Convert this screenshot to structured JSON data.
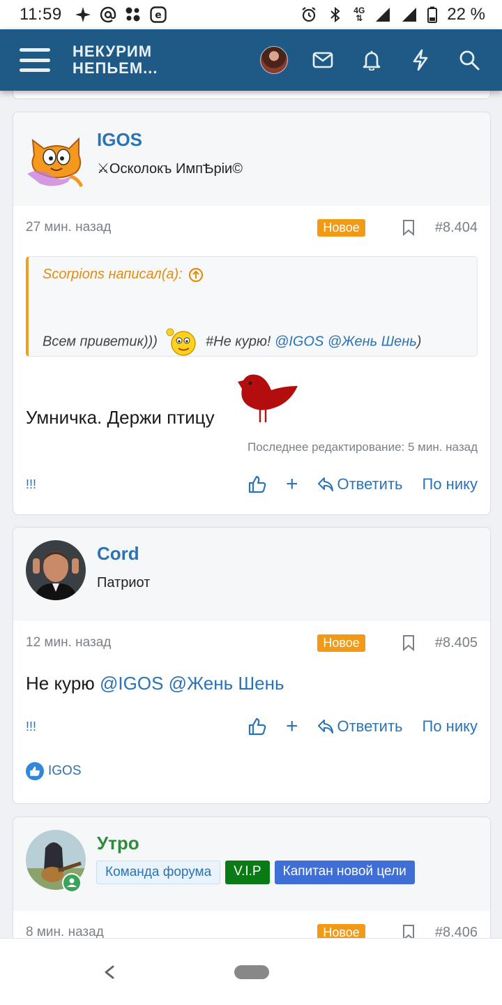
{
  "status_bar": {
    "time": "11:59",
    "battery": "22 %",
    "network": "4G",
    "icons": [
      "sparkle-icon",
      "at-icon",
      "dots-icon",
      "e-icon",
      "alarm-icon",
      "bluetooth-icon",
      "signal-icon",
      "battery-icon"
    ]
  },
  "header": {
    "logo_line1": "НЕКУРИМ",
    "logo_line2": "НЕПЬЕМ...",
    "icons": [
      "menu-icon",
      "avatar",
      "mail-icon",
      "bell-icon",
      "bolt-icon",
      "search-icon"
    ]
  },
  "posts": [
    {
      "username": "IGOS",
      "user_title": "⚔Осколокъ ИмпѢріи©",
      "time": "27 мин. назад",
      "badge": "Новое",
      "post_number": "#8.404",
      "quote": {
        "author": "Scorpions написал(а):",
        "text_before": "Всем приветик)))",
        "text_middle": "#Не курю!",
        "mention1": "@IGOS",
        "mention2": "@Жень Шень",
        "text_after": ")"
      },
      "text": "Умничка. Держи птицу",
      "edited": "Последнее редактирование: 5 мин. назад",
      "actions": {
        "report": "!!!",
        "plus": "+",
        "reply": "Ответить",
        "by_nick": "По нику"
      }
    },
    {
      "username": "Cord",
      "user_title": "Патриот",
      "time": "12 мин. назад",
      "badge": "Новое",
      "post_number": "#8.405",
      "text_before": "Не курю",
      "mention1": "@IGOS",
      "mention2": "@Жень Шень",
      "actions": {
        "report": "!!!",
        "plus": "+",
        "reply": "Ответить",
        "by_nick": "По нику"
      },
      "reaction_user": "IGOS"
    },
    {
      "username": "Утро",
      "banners": [
        "Команда форума",
        "V.I.P",
        "Капитан новой цели"
      ],
      "time": "8 мин. назад",
      "badge": "Новое",
      "post_number": "#8.406"
    }
  ],
  "colors": {
    "header_bg": "#1f5a86",
    "link": "#2a73b4",
    "badge_new": "#f09a17",
    "username_green": "#2e8b3a"
  }
}
